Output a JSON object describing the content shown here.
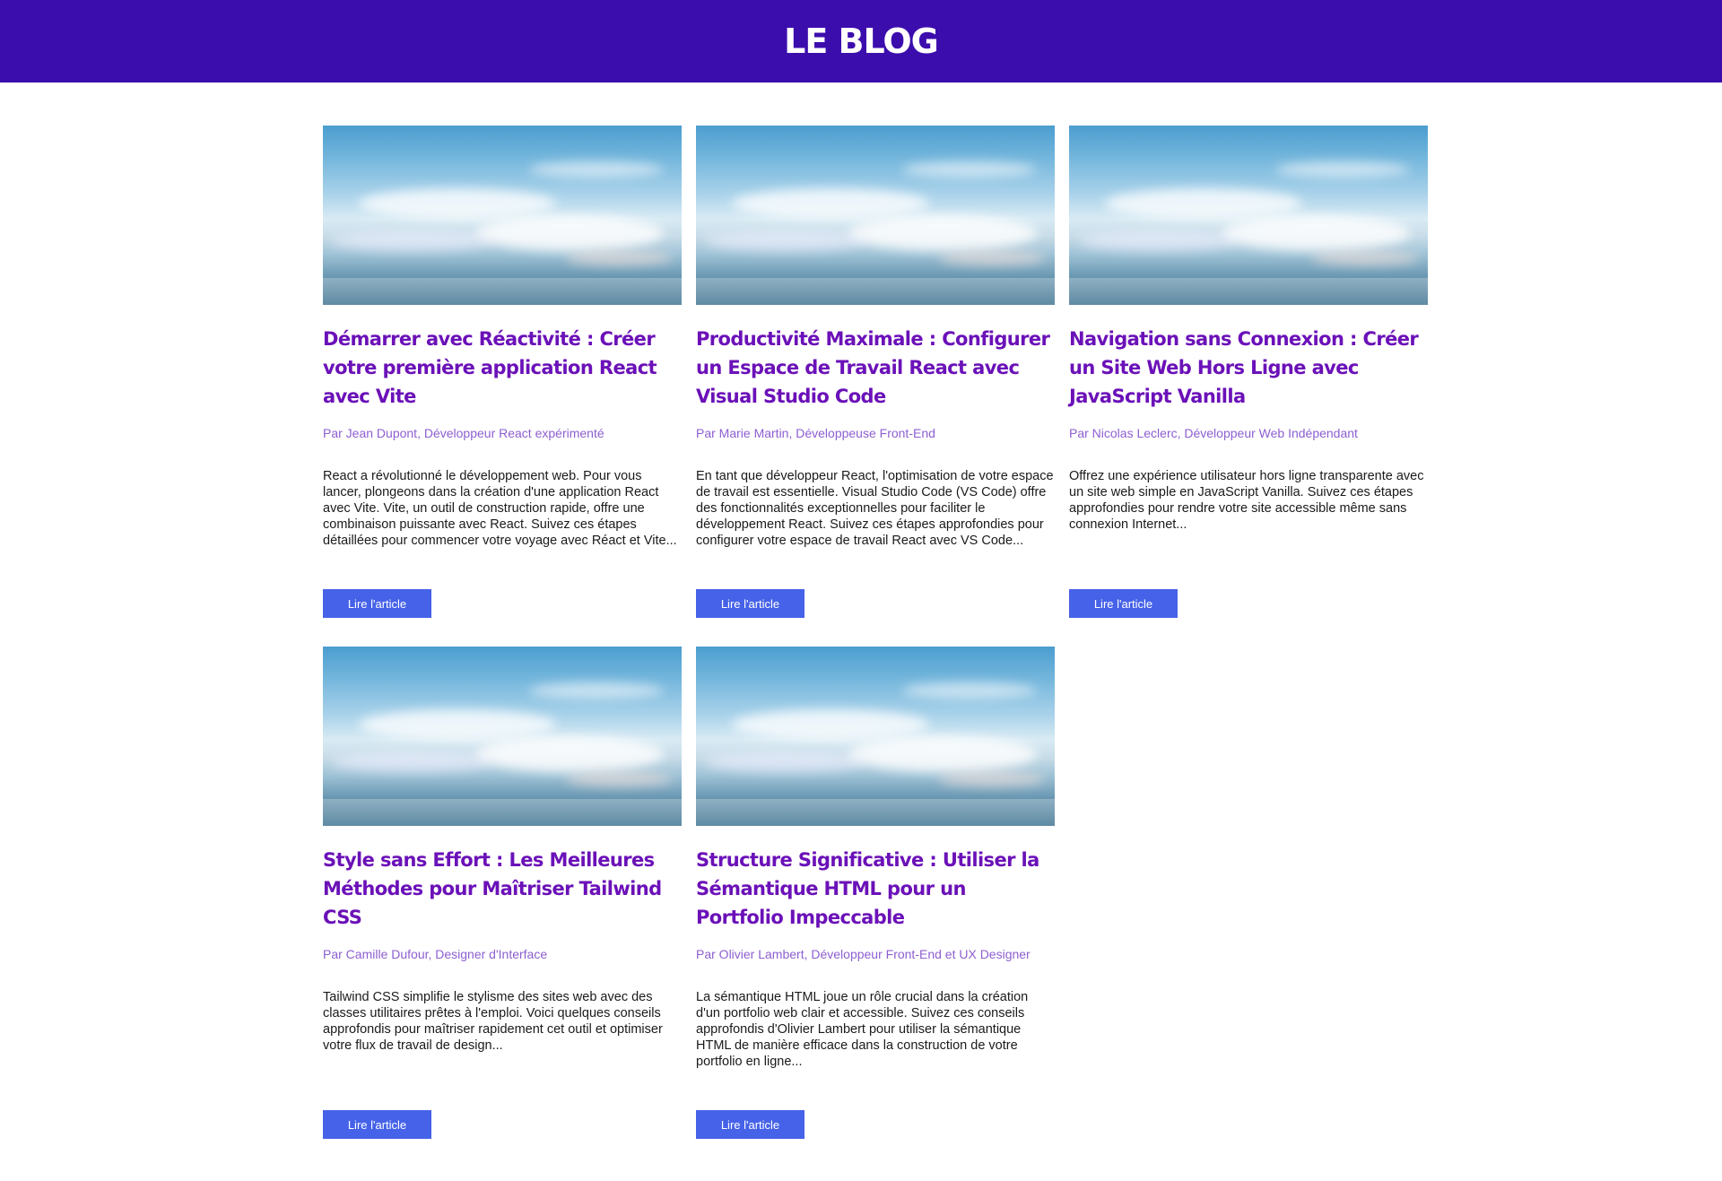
{
  "header": {
    "title": "LE BLOG",
    "background": "#3c0dad"
  },
  "theme": {
    "title_color": "#6b11b8",
    "author_color": "#8d5fd0",
    "button_color": "#4662e8"
  },
  "articles": [
    {
      "title": "Démarrer avec Réactivité : Créer votre première application React avec Vite",
      "author": "Par Jean Dupont, Développeur React expérimenté",
      "excerpt": "React a révolutionné le développement web. Pour vous lancer, plongeons dans la création d'une application React avec Vite. Vite, un outil de construction rapide, offre une combinaison puissante avec React. Suivez ces étapes détaillées pour commencer votre voyage avec Réact et Vite...",
      "button": "Lire l'article"
    },
    {
      "title": "Productivité Maximale : Configurer un Espace de Travail React avec Visual Studio Code",
      "author": "Par Marie Martin, Développeuse Front-End",
      "excerpt": "En tant que développeur React, l'optimisation de votre espace de travail est essentielle. Visual Studio Code (VS Code) offre des fonctionnalités exceptionnelles pour faciliter le développement React. Suivez ces étapes approfondies pour configurer votre espace de travail React avec VS Code...",
      "button": "Lire l'article"
    },
    {
      "title": "Navigation sans Connexion : Créer un Site Web Hors Ligne avec JavaScript Vanilla",
      "author": "Par Nicolas Leclerc, Développeur Web Indépendant",
      "excerpt": "Offrez une expérience utilisateur hors ligne transparente avec un site web simple en JavaScript Vanilla. Suivez ces étapes approfondies pour rendre votre site accessible même sans connexion Internet...",
      "button": "Lire l'article"
    },
    {
      "title": "Style sans Effort : Les Meilleures Méthodes pour Maîtriser Tailwind CSS",
      "author": "Par Camille Dufour, Designer d'Interface",
      "excerpt": "Tailwind CSS simplifie le stylisme des sites web avec des classes utilitaires prêtes à l'emploi. Voici quelques conseils approfondis pour maîtriser rapidement cet outil et optimiser votre flux de travail de design...",
      "button": "Lire l'article"
    },
    {
      "title": "Structure Significative : Utiliser la Sémantique HTML pour un Portfolio Impeccable",
      "author": "Par Olivier Lambert, Développeur Front-End et UX Designer",
      "excerpt": "La sémantique HTML joue un rôle crucial dans la création d'un portfolio web clair et accessible. Suivez ces conseils approfondis d'Olivier Lambert pour utiliser la sémantique HTML de manière efficace dans la construction de votre portfolio en ligne...",
      "button": "Lire l'article"
    }
  ]
}
